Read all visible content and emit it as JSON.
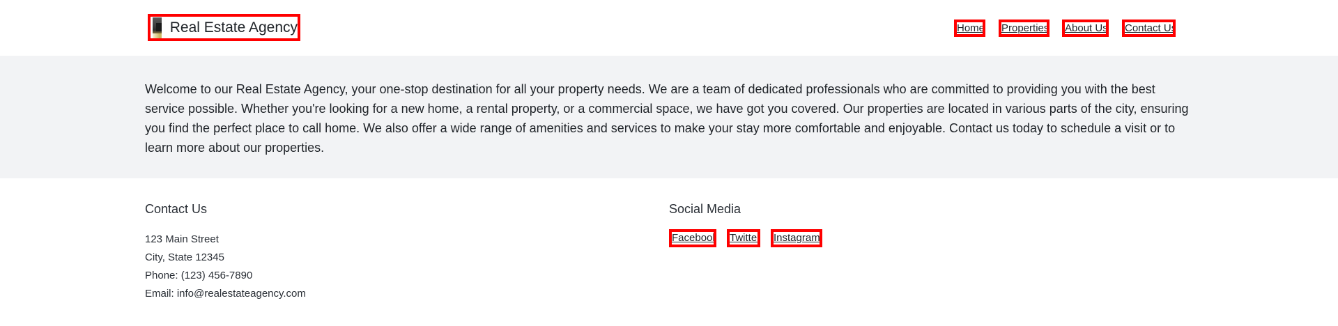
{
  "header": {
    "brand_name": "Real Estate Agency",
    "logo_icon": "house-photo-logo",
    "nav": [
      {
        "label": "Home"
      },
      {
        "label": "Properties"
      },
      {
        "label": "About Us"
      },
      {
        "label": "Contact Us"
      }
    ]
  },
  "intro": {
    "text": "Welcome to our Real Estate Agency, your one-stop destination for all your property needs. We are a team of dedicated professionals who are committed to providing you with the best service possible. Whether you're looking for a new home, a rental property, or a commercial space, we have got you covered. Our properties are located in various parts of the city, ensuring you find the perfect place to call home. We also offer a wide range of amenities and services to make your stay more comfortable and enjoyable. Contact us today to schedule a visit or to learn more about our properties."
  },
  "footer": {
    "contact": {
      "title": "Contact Us",
      "street": "123 Main Street",
      "city": "City, State 12345",
      "phone": "Phone: (123) 456-7890",
      "email": "Email: info@realestateagency.com"
    },
    "social": {
      "title": "Social Media",
      "links": [
        {
          "label": "Facebook"
        },
        {
          "label": "Twitter"
        },
        {
          "label": "Instagram"
        }
      ]
    }
  },
  "colors": {
    "highlight_border": "#ff0000",
    "intro_background": "#f2f3f5",
    "text": "#1f2328"
  }
}
